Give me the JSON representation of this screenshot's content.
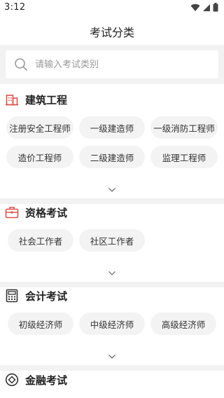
{
  "status_bar": {
    "time": "3:12",
    "icons": [
      "wifi-icon",
      "cellular-signal-icon",
      "battery-icon"
    ]
  },
  "header": {
    "title": "考试分类"
  },
  "search": {
    "placeholder": "请输入考试类别",
    "value": "",
    "icon": "search-icon"
  },
  "expand_icon": "chevron-down-icon",
  "sections": [
    {
      "title": "建筑工程",
      "icon": "building-icon",
      "icon_color": "#d9534f",
      "items": [
        "注册安全工程师",
        "一级建造师",
        "一级消防工程师",
        "造价工程师",
        "二级建造师",
        "监理工程师"
      ]
    },
    {
      "title": "资格考试",
      "icon": "briefcase-icon",
      "icon_color": "#d9534f",
      "items": [
        "社会工作者",
        "社区工作者"
      ]
    },
    {
      "title": "会计考试",
      "icon": "calculator-icon",
      "icon_color": "#333333",
      "items": [
        "初级经济师",
        "中级经济师",
        "高级经济师"
      ]
    },
    {
      "title": "金融考试",
      "icon": "finance-icon",
      "icon_color": "#333333",
      "items": []
    }
  ],
  "colors": {
    "chip_bg": "#f3f3f3",
    "page_bg": "#ffffff",
    "divider_bg": "#f2f2f2",
    "text": "#222222"
  }
}
